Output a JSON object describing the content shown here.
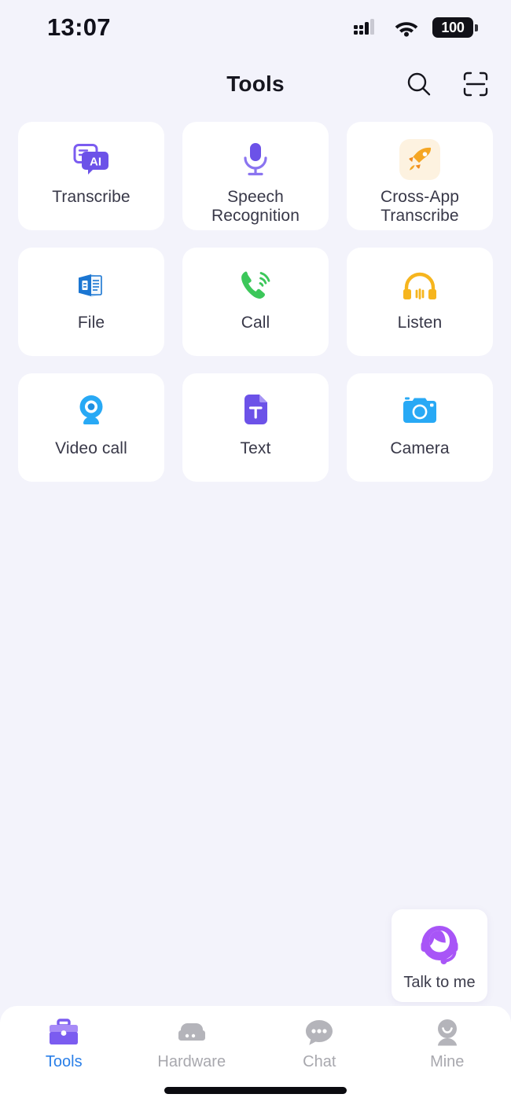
{
  "status_bar": {
    "time": "13:07",
    "signal_icon": "cellular-signal-icon",
    "wifi_icon": "wifi-icon",
    "battery_level": "100"
  },
  "header": {
    "title": "Tools",
    "search_icon": "search-icon",
    "scan_icon": "scan-icon"
  },
  "tools": [
    {
      "label": "Transcribe",
      "icon": "ai-transcribe-icon"
    },
    {
      "label": "Speech Recognition",
      "icon": "microphone-icon"
    },
    {
      "label": "Cross-App Transcribe",
      "icon": "rocket-icon"
    },
    {
      "label": "File",
      "icon": "document-file-icon"
    },
    {
      "label": "Call",
      "icon": "phone-call-icon"
    },
    {
      "label": "Listen",
      "icon": "headphones-icon"
    },
    {
      "label": "Video call",
      "icon": "webcam-icon"
    },
    {
      "label": "Text",
      "icon": "text-document-icon"
    },
    {
      "label": "Camera",
      "icon": "camera-icon"
    }
  ],
  "talk_widget": {
    "label": "Talk to me",
    "icon": "support-headset-avatar-icon"
  },
  "tabbar": {
    "items": [
      {
        "label": "Tools",
        "icon": "toolbox-icon",
        "active": true
      },
      {
        "label": "Hardware",
        "icon": "device-icon",
        "active": false
      },
      {
        "label": "Chat",
        "icon": "chat-bubble-icon",
        "active": false
      },
      {
        "label": "Mine",
        "icon": "person-icon",
        "active": false
      }
    ]
  },
  "colors": {
    "background": "#f3f3fb",
    "card": "#ffffff",
    "accent_purple": "#7b5cf0",
    "accent_blue": "#2a7fe8",
    "text_primary": "#383848",
    "text_muted": "#a8a8ae"
  }
}
